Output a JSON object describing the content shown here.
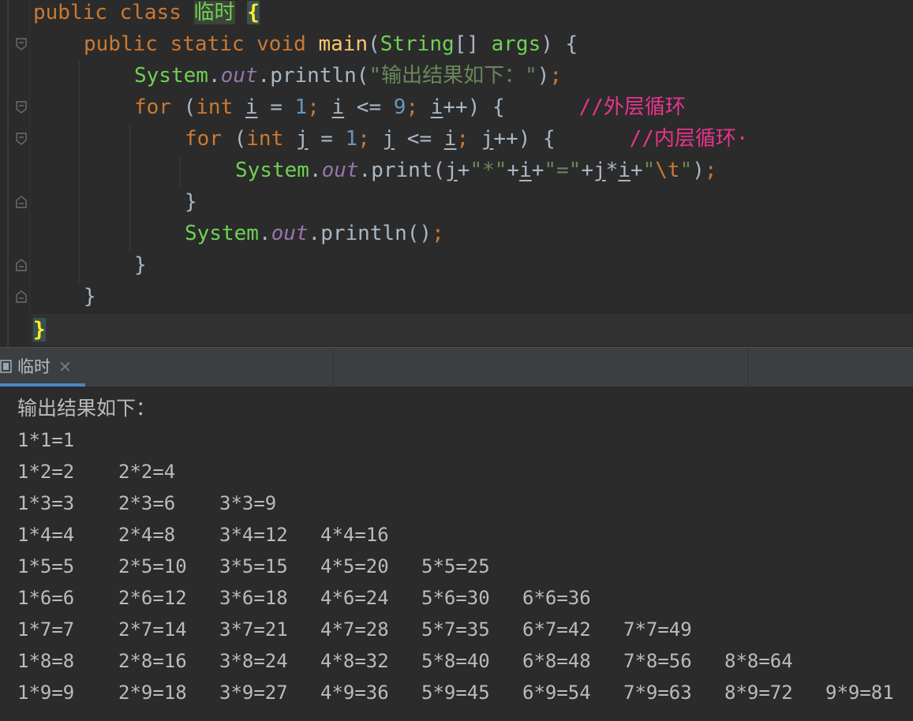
{
  "editor": {
    "class_decl": {
      "kw_public": "public",
      "kw_class": "class",
      "class_name": "临时",
      "open_brace": "{"
    },
    "main_decl": {
      "kw_public": "public",
      "kw_static": "static",
      "kw_void": "void",
      "method_name": "main",
      "paren_open": "(",
      "param_type": "String",
      "brackets": "[] ",
      "param_name": "args",
      "paren_close": ") {"
    },
    "println_line": {
      "system": "System",
      "dot1": ".",
      "out": "out",
      "dot2": ".println(",
      "string": "\"输出结果如下：\"",
      "close": ")",
      "semi": ";"
    },
    "outer_for": {
      "kw_for": "for",
      "p1": " (",
      "kw_int": "int",
      "var_i": "i",
      "eq": " = ",
      "one": "1",
      "semi1": ";",
      "var_i2": "i",
      "le": " <= ",
      "nine": "9",
      "semi2": ";",
      "var_i3": "i",
      "inc": "++) {",
      "comment": "//外层循环"
    },
    "inner_for": {
      "kw_for": "for",
      "p1": " (",
      "kw_int": "int",
      "var_j": "j",
      "eq": " = ",
      "one": "1",
      "semi1": ";",
      "var_j2": "j",
      "le": " <= ",
      "var_i": "i",
      "semi2": ";",
      "var_j3": "j",
      "inc": "++) {",
      "comment": "//内层循环·"
    },
    "print_line": {
      "system": "System",
      "dot1": ".",
      "out": "out",
      "dot2": ".print(",
      "j1": "j",
      "plus1": "+",
      "str_star": "\"*\"",
      "plus2": "+",
      "i1": "i",
      "plus3": "+",
      "str_eq": "\"=\"",
      "plus4": "+",
      "j2": "j",
      "star": "*",
      "i2": "i",
      "plus5": "+",
      "str_tab_open": "\"",
      "str_tab_esc": "\\t",
      "str_tab_close": "\"",
      "close": ")",
      "semi": ";"
    },
    "inner_close": "}",
    "newline_line": {
      "system": "System",
      "dot1": ".",
      "out": "out",
      "rest": ".println()",
      "semi": ";"
    },
    "outer_close": "}",
    "main_close": "}",
    "class_close": "}"
  },
  "run_panel": {
    "tab_label": "临时",
    "tab_close": "✕",
    "accent_color": "#4a88c7"
  },
  "console": {
    "title": "输出结果如下：",
    "rows": [
      [
        "1*1=1"
      ],
      [
        "1*2=2",
        "2*2=4"
      ],
      [
        "1*3=3",
        "2*3=6",
        "3*3=9"
      ],
      [
        "1*4=4",
        "2*4=8",
        "3*4=12",
        "4*4=16"
      ],
      [
        "1*5=5",
        "2*5=10",
        "3*5=15",
        "4*5=20",
        "5*5=25"
      ],
      [
        "1*6=6",
        "2*6=12",
        "3*6=18",
        "4*6=24",
        "5*6=30",
        "6*6=36"
      ],
      [
        "1*7=7",
        "2*7=14",
        "3*7=21",
        "4*7=28",
        "5*7=35",
        "6*7=42",
        "7*7=49"
      ],
      [
        "1*8=8",
        "2*8=16",
        "3*8=24",
        "4*8=32",
        "5*8=40",
        "6*8=48",
        "7*8=56",
        "8*8=64"
      ],
      [
        "1*9=9",
        "2*9=18",
        "3*9=27",
        "4*9=36",
        "5*9=45",
        "6*9=54",
        "7*9=63",
        "8*9=72",
        "9*9=81"
      ]
    ]
  }
}
